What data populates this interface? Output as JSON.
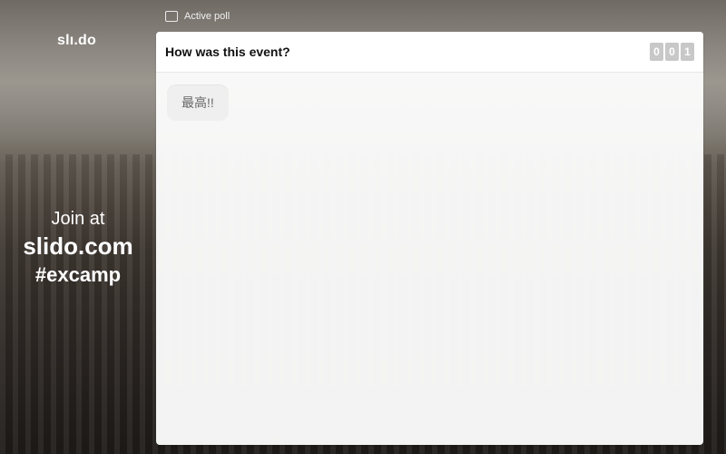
{
  "app": {
    "logo_text": "slı.do"
  },
  "top": {
    "active_poll_label": "Active poll",
    "icon": "poll-icon"
  },
  "left": {
    "join_at": "Join at",
    "url": "slido.com",
    "event_code": "#excamp"
  },
  "panel": {
    "question": "How was this event?",
    "counter_digits": [
      "0",
      "0",
      "1"
    ],
    "answers": [
      {
        "text": "最高!!"
      }
    ]
  }
}
